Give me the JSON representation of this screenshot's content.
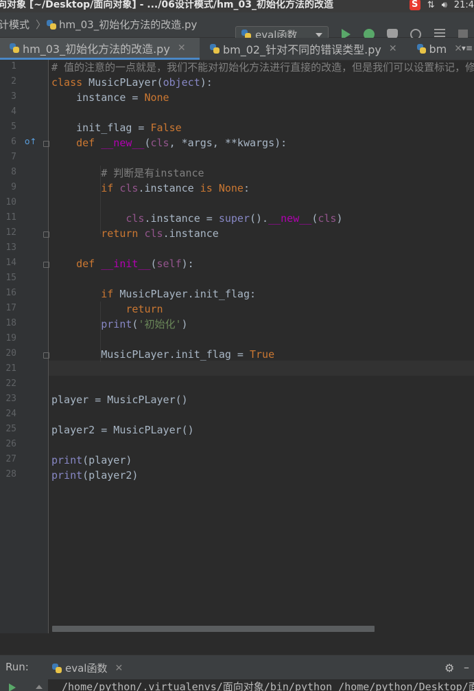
{
  "window": {
    "title": "向对象 [~/Desktop/面向对象] - .../06设计模式/hm_03_初始化方法的改造",
    "tray_clock": "21:4"
  },
  "navbar": {
    "breadcrumb_parent": "计模式",
    "breadcrumb_file": "hm_03_初始化方法的改造.py",
    "run_config": "eval函数"
  },
  "tabs": [
    {
      "label": "hm_03_初始化方法的改造.py"
    },
    {
      "label": "bm_02_针对不同的错误类型.py"
    },
    {
      "label": "bm"
    }
  ],
  "editor": {
    "line_numbers": [
      "1",
      "2",
      "3",
      "4",
      "5",
      "6",
      "7",
      "8",
      "9",
      "10",
      "11",
      "12",
      "13",
      "14",
      "15",
      "16",
      "17",
      "18",
      "19",
      "20",
      "21",
      "22",
      "23",
      "24",
      "25",
      "26",
      "27",
      "28"
    ],
    "comment_line1": "# 值的注意的一点就是，我们不能对初始化方法进行直接的改造，但是我们可以设置标记，修",
    "comment_line8": "# 判断是有instance",
    "print_str": "'初始化'"
  },
  "run_panel": {
    "label": "Run:",
    "tab": "eval函数",
    "console_output": "/home/python/.virtualenvs/面向对象/bin/python /home/python/Desktop/面"
  },
  "colors": {
    "background": "#2b2b2b",
    "keyword": "#cc7832",
    "comment": "#808080",
    "string": "#6a8759",
    "accent": "#4a88c7"
  }
}
